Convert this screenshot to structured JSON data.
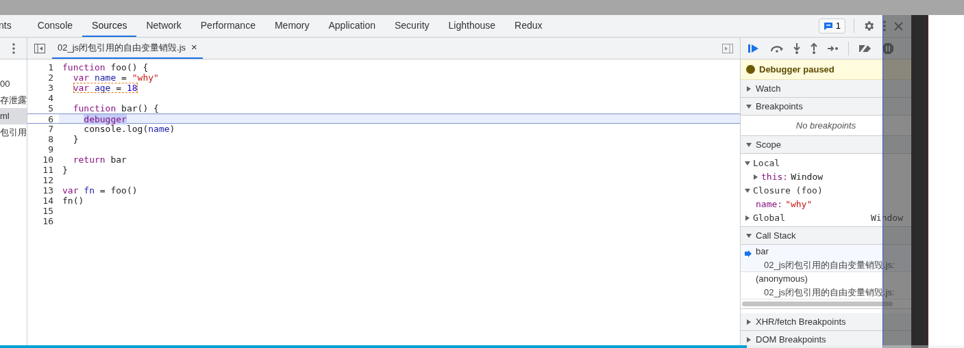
{
  "tabs": [
    {
      "label": "nts",
      "selected": false
    },
    {
      "label": "Console",
      "selected": false
    },
    {
      "label": "Sources",
      "selected": true
    },
    {
      "label": "Network",
      "selected": false
    },
    {
      "label": "Performance",
      "selected": false
    },
    {
      "label": "Memory",
      "selected": false
    },
    {
      "label": "Application",
      "selected": false
    },
    {
      "label": "Security",
      "selected": false
    },
    {
      "label": "Lighthouse",
      "selected": false
    },
    {
      "label": "Redux",
      "selected": false
    }
  ],
  "issues_badge": "1",
  "navigator": [
    {
      "label": "00",
      "selected": false
    },
    {
      "label": "存泄露",
      "selected": false
    },
    {
      "label": "ml",
      "selected": true
    },
    {
      "label": "包引用",
      "selected": false
    }
  ],
  "file_tab": {
    "name": "02_js闭包引用的自由变量销毁.js",
    "close": "×"
  },
  "code_lines": [
    {
      "number": "1",
      "current": false,
      "annotated": false,
      "tokens": [
        {
          "text": "function",
          "kind": "keyword"
        },
        {
          "text": " foo() {",
          "kind": "plain"
        }
      ]
    },
    {
      "number": "2",
      "current": false,
      "annotated": false,
      "tokens": [
        {
          "text": "  var",
          "kind": "keyword"
        },
        {
          "text": " name",
          "kind": "def"
        },
        {
          "text": " = ",
          "kind": "plain"
        },
        {
          "text": "\"why\"",
          "kind": "string"
        }
      ]
    },
    {
      "number": "3",
      "current": false,
      "annotated": true,
      "tokens": [
        {
          "text": "  var",
          "kind": "keyword"
        },
        {
          "text": " age",
          "kind": "def"
        },
        {
          "text": " = ",
          "kind": "plain"
        },
        {
          "text": "18",
          "kind": "number"
        }
      ]
    },
    {
      "number": "4",
      "current": false,
      "annotated": false
    },
    {
      "number": "5",
      "current": false,
      "annotated": false,
      "tokens": [
        {
          "text": "  function",
          "kind": "keyword"
        },
        {
          "text": " bar() {",
          "kind": "plain"
        }
      ]
    },
    {
      "number": "6",
      "current": true,
      "annotated": false,
      "tokens": [
        {
          "text": "    debugger",
          "kind": "paused"
        }
      ]
    },
    {
      "number": "7",
      "current": false,
      "annotated": false,
      "tokens": [
        {
          "text": "    console.log(",
          "kind": "plain"
        },
        {
          "text": "name",
          "kind": "def"
        },
        {
          "text": ")",
          "kind": "plain"
        }
      ]
    },
    {
      "number": "8",
      "current": false,
      "annotated": false,
      "tokens": [
        {
          "text": "  }",
          "kind": "plain"
        }
      ]
    },
    {
      "number": "9",
      "current": false,
      "annotated": false
    },
    {
      "number": "10",
      "current": false,
      "annotated": false,
      "tokens": [
        {
          "text": "  return",
          "kind": "keyword"
        },
        {
          "text": " bar",
          "kind": "plain"
        }
      ]
    },
    {
      "number": "11",
      "current": false,
      "annotated": false,
      "tokens": [
        {
          "text": "}",
          "kind": "plain"
        }
      ]
    },
    {
      "number": "12",
      "current": false,
      "annotated": false
    },
    {
      "number": "13",
      "current": false,
      "annotated": false,
      "tokens": [
        {
          "text": "var",
          "kind": "keyword"
        },
        {
          "text": " fn",
          "kind": "def"
        },
        {
          "text": " = foo()",
          "kind": "plain"
        }
      ]
    },
    {
      "number": "14",
      "current": false,
      "annotated": false,
      "tokens": [
        {
          "text": "fn()",
          "kind": "plain"
        }
      ]
    },
    {
      "number": "15",
      "current": false,
      "annotated": false
    },
    {
      "number": "16",
      "current": false,
      "annotated": false
    }
  ],
  "debugger_panel": [
    {
      "kind": "banner",
      "text": "Debugger paused"
    },
    {
      "kind": "section",
      "title": "Watch",
      "expanded": false
    },
    {
      "kind": "section",
      "title": "Breakpoints",
      "expanded": true
    },
    {
      "kind": "empty",
      "text": "No breakpoints"
    },
    {
      "kind": "section",
      "title": "Scope",
      "expanded": true
    },
    {
      "kind": "scope",
      "label": "Local",
      "expanded": true,
      "children": [
        {
          "key": "this:",
          "value": "Window",
          "kind": "object",
          "expanded": false
        }
      ]
    },
    {
      "kind": "scope",
      "label": "Closure (foo)",
      "expanded": true,
      "children": [
        {
          "key": "name:",
          "value": "\"why\"",
          "kind": "string"
        }
      ]
    },
    {
      "kind": "scope",
      "label": "Global",
      "value": "Window",
      "expanded": false
    },
    {
      "kind": "section",
      "title": "Call Stack",
      "expanded": true
    },
    {
      "kind": "frame",
      "name": "bar",
      "location": "02_js闭包引用的自由变量销毁.js:",
      "selected": true
    },
    {
      "kind": "frame",
      "name": "(anonymous)",
      "location": "02_js闭包引用的自由变量销毁.js:",
      "selected": false
    },
    {
      "kind": "scrollbar"
    },
    {
      "kind": "section",
      "title": "XHR/fetch Breakpoints",
      "expanded": false
    },
    {
      "kind": "section",
      "title": "DOM Breakpoints",
      "expanded": false
    }
  ],
  "video_progress": {
    "level": 0.775
  }
}
